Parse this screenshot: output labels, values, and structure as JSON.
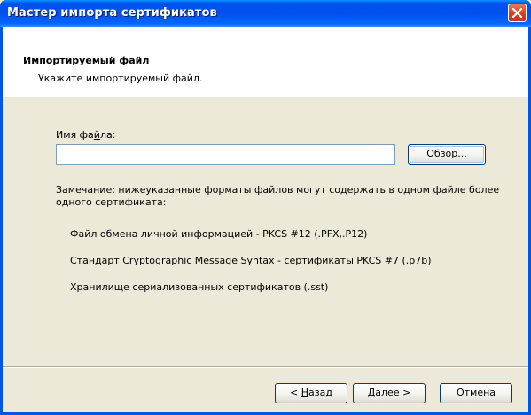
{
  "window": {
    "title": "Мастер импорта сертификатов"
  },
  "header": {
    "title": "Импортируемый файл",
    "subtitle": "Укажите импортируемый файл."
  },
  "file": {
    "label_pre": "Имя фа",
    "label_ul": "й",
    "label_post": "ла:",
    "value": "",
    "placeholder": "",
    "browse_ul": "О",
    "browse_rest": "бзор..."
  },
  "note": "Замечание: нижеуказанные форматы файлов могут содержать в одном файле более одного сертификата:",
  "formats": [
    "Файл обмена личной информацией - PKCS #12 (.PFX,.P12)",
    "Стандарт Cryptographic Message Syntax - сертификаты PKCS #7 (.p7b)",
    "Хранилище сериализованных сертификатов (.sst)"
  ],
  "buttons": {
    "back_pre": "< ",
    "back_ul": "Н",
    "back_post": "азад",
    "next_ul": "Д",
    "next_post": "алее >",
    "cancel": "Отмена"
  },
  "colors": {
    "titlebar": "#0054E3",
    "dialog_bg": "#ECE9D8",
    "close_button": "#D4421F",
    "input_border": "#7F9DB9"
  }
}
